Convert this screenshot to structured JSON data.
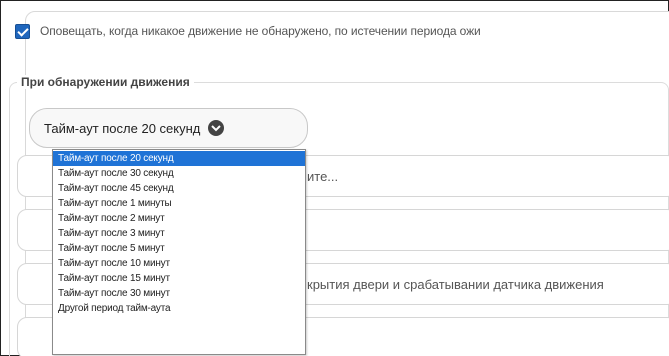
{
  "notify": {
    "checked": true,
    "label": "Оповещать, когда никакое движение не обнаружено, по истечении периода ожи"
  },
  "motion_group": {
    "title": "При обнаружении движения",
    "timeout_select": {
      "selected": "Тайм-аут после 20 секунд",
      "options": [
        "Тайм-аут после 20 секунд",
        "Тайм-аут после 30 секунд",
        "Тайм-аут после 45 секунд",
        "Тайм-аут после 1 минуты",
        "Тайм-аут после 2 минут",
        "Тайм-аут после 3 минут",
        "Тайм-аут после 5 минут",
        "Тайм-аут после 10 минут",
        "Тайм-аут после 15 минут",
        "Тайм-аут после 30 минут",
        "Другой период тайм-аута"
      ]
    },
    "fields": {
      "field_1_text": "ите...",
      "field_2_text": "",
      "field_3_text": "крытия двери и срабатывании датчика движения",
      "field_4_text": ""
    }
  },
  "colors": {
    "accent": "#1f73d6",
    "checkbox": "#1f66bd"
  }
}
